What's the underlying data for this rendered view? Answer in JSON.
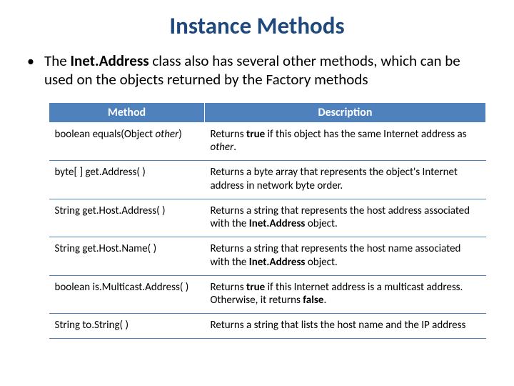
{
  "title": "Instance Methods",
  "bullet_pre": "The ",
  "bullet_b": "Inet.Address",
  "bullet_post": " class also has several other methods, which can be used on the objects returned by the Factory methods",
  "headers": {
    "method": "Method",
    "description": "Description"
  },
  "rows": [
    {
      "m_pre": "boolean equals(Object ",
      "m_ital": "other",
      "m_post": ")",
      "d1": "Returns ",
      "d2_b": "true",
      "d3": " if this object has the same Internet address as ",
      "d4_ital": "other",
      "d5": "."
    },
    {
      "m_pre": "byte[ ] get.Address( )",
      "m_ital": "",
      "m_post": "",
      "d1": "Returns a byte array that represents the object's Internet address in network byte order.",
      "d2_b": "",
      "d3": "",
      "d4_ital": "",
      "d5": ""
    },
    {
      "m_pre": "String get.Host.Address( )",
      "m_ital": "",
      "m_post": "",
      "d1": "Returns a string that represents the host address associated with the ",
      "d2_b": "Inet.Address",
      "d3": " object.",
      "d4_ital": "",
      "d5": ""
    },
    {
      "m_pre": "String get.Host.Name( )",
      "m_ital": "",
      "m_post": "",
      "d1": "Returns a string that represents the host name associated with the ",
      "d2_b": "Inet.Address",
      "d3": " object.",
      "d4_ital": "",
      "d5": ""
    },
    {
      "m_pre": "boolean is.Multicast.Address( )",
      "m_ital": "",
      "m_post": "",
      "d1": "Returns ",
      "d2_b": "true",
      "d3": " if this Internet address is a multicast address. Otherwise, it returns ",
      "d4_ital": "",
      "d5": "",
      "d6_b": "false",
      "d7": "."
    },
    {
      "m_pre": "String to.String( )",
      "m_ital": "",
      "m_post": "",
      "d1": "Returns a string that lists the host name and the IP address",
      "d2_b": "",
      "d3": "",
      "d4_ital": "",
      "d5": ""
    }
  ]
}
